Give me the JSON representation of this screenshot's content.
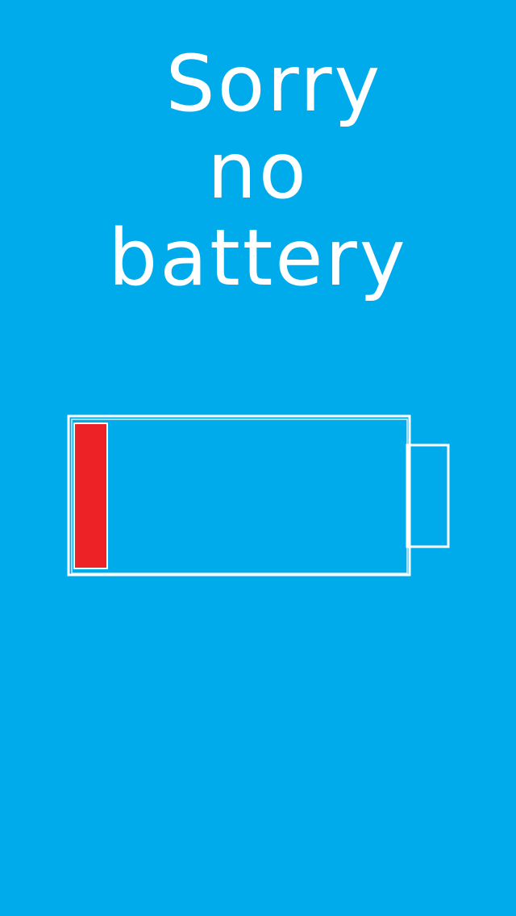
{
  "message": {
    "lines": [
      "Sorry",
      "no",
      "battery"
    ]
  },
  "battery": {
    "level": 0.1,
    "charge_color": "#ec2227",
    "outline_color": "#ffffff"
  },
  "colors": {
    "background": "#00abec",
    "text": "#ffffff"
  }
}
